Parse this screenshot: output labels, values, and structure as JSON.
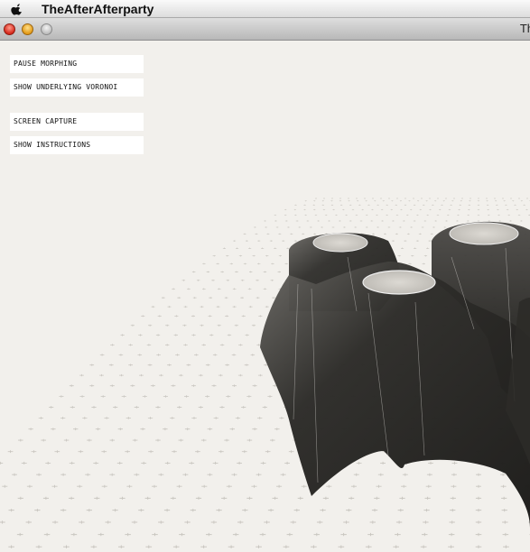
{
  "menubar": {
    "app_name": "TheAfterAfterparty",
    "apple_icon": "apple-icon"
  },
  "window": {
    "title": "Th"
  },
  "controls": {
    "pause_morphing": "PAUSE MORPHING",
    "show_voronoi": "SHOW UNDERLYING VORONOI",
    "screen_capture": "SCREEN CAPTURE",
    "show_instructions": "SHOW INSTRUCTIONS"
  },
  "colors": {
    "canvas_bg": "#f2f0ec",
    "grid_mark": "#c9c6c0",
    "mesh_dark": "#2b2a27",
    "cap_light": "#cfccc6"
  }
}
